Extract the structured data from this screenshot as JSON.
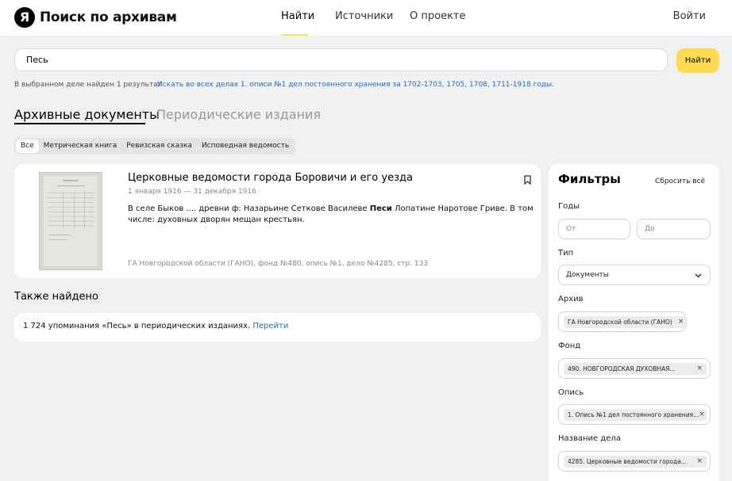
{
  "header": {
    "logo_letter": "Я",
    "logo_text": "Поиск по архивам",
    "nav": [
      "Найти",
      "Источники",
      "О проекте"
    ],
    "login": "Войти"
  },
  "search": {
    "value": "Песь",
    "button": "Найти",
    "result_note": "В выбранном деле найден 1 результат",
    "search_all_link": "Искать во всех делах 1. описи №1 дел постоянного хранения за 1702-1703, 1705, 1708, 1711-1918 годы."
  },
  "tabs": {
    "archival": "Архивные документы",
    "periodicals": "Периодические издания"
  },
  "chips": [
    "Все",
    "Метрическая книга",
    "Ревизская сказка",
    "Исповедная ведомость"
  ],
  "result": {
    "title": "Церковные ведомости города Боровичи и его уезда",
    "date": "1 января 1916 — 31 декабря 1916",
    "text_before": "В селе Быков .... древни ф: Назарьине Сеткове Василеве ",
    "text_highlight": "Песи",
    "text_after": " Лопатине Наротове Гриве. В том числе: духовных дворян мещан крестьян.",
    "source": "ГА Новгородской области (ГАНО), фонд №480, опись №1, дело №4285, стр. 133"
  },
  "also_found": {
    "title": "Также найдено",
    "text": "1 724 упоминания «Песь» в периодических изданиях.",
    "link": "Перейти"
  },
  "filters": {
    "title": "Фильтры",
    "reset": "Сбросить всё",
    "years_label": "Годы",
    "from_placeholder": "От",
    "to_placeholder": "До",
    "type_label": "Тип",
    "type_value": "Документы",
    "archive_label": "Архив",
    "archive_tag": "ГА Новгородской области (ГАНО)",
    "fond_label": "Фонд",
    "fond_tag": "490. НОВГОРОДСКАЯ ДУХОВНАЯ...",
    "opis_label": "Опись",
    "opis_tag": "1. Опись №1 дел постоянного хранения...",
    "case_label": "Название дела",
    "case_tag": "4285. Церковные ведомости города..."
  }
}
